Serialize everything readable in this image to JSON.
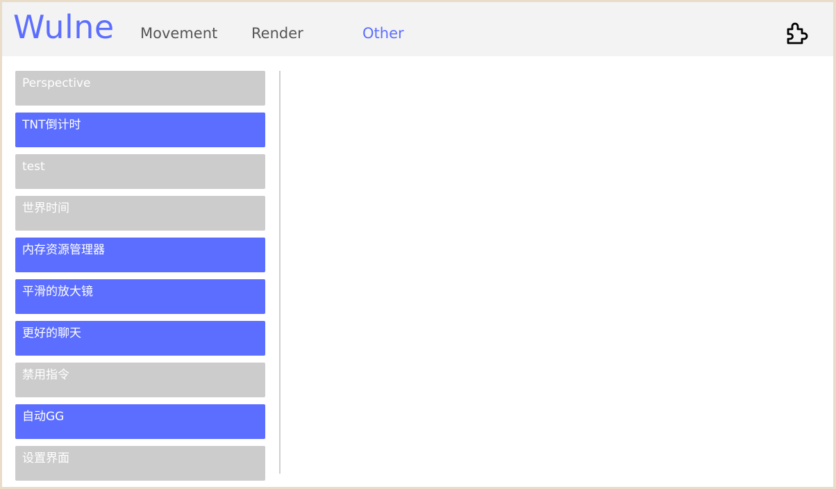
{
  "app": {
    "logo": "Wulne"
  },
  "tabs": [
    {
      "label": "Movement",
      "active": false
    },
    {
      "label": "Render",
      "active": false
    },
    {
      "label": "Other",
      "active": true
    }
  ],
  "icons": {
    "plugin": "puzzle-icon"
  },
  "colors": {
    "accent": "#5c6eff",
    "module_off": "#cccccc",
    "header_bg": "#f3f3f3"
  },
  "modules": [
    {
      "label": "Perspective",
      "enabled": false
    },
    {
      "label": "TNT倒计时",
      "enabled": true
    },
    {
      "label": "test",
      "enabled": false
    },
    {
      "label": "世界时间",
      "enabled": false
    },
    {
      "label": "内存资源管理器",
      "enabled": true
    },
    {
      "label": "平滑的放大镜",
      "enabled": true
    },
    {
      "label": "更好的聊天",
      "enabled": true
    },
    {
      "label": "禁用指令",
      "enabled": false
    },
    {
      "label": "自动GG",
      "enabled": true
    },
    {
      "label": "设置界面",
      "enabled": false
    }
  ]
}
